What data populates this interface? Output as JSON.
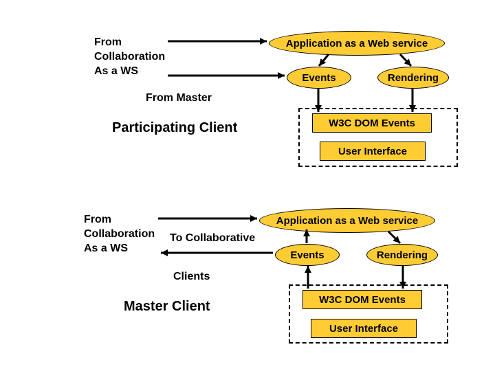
{
  "upper": {
    "from_label": "From\nCollaboration\nAs a WS",
    "from_master": "From Master",
    "title": "Participating Client",
    "app_ws": "Application as a Web service",
    "events": "Events",
    "rendering": "Rendering",
    "w3c": "W3C DOM Events",
    "ui": "User Interface"
  },
  "lower": {
    "from_label": "From\nCollaboration\nAs a WS",
    "to_collab": "To Collaborative",
    "clients": "Clients",
    "title": "Master Client",
    "app_ws": "Application as a Web service",
    "events": "Events",
    "rendering": "Rendering",
    "w3c": "W3C DOM Events",
    "ui": "User Interface"
  }
}
